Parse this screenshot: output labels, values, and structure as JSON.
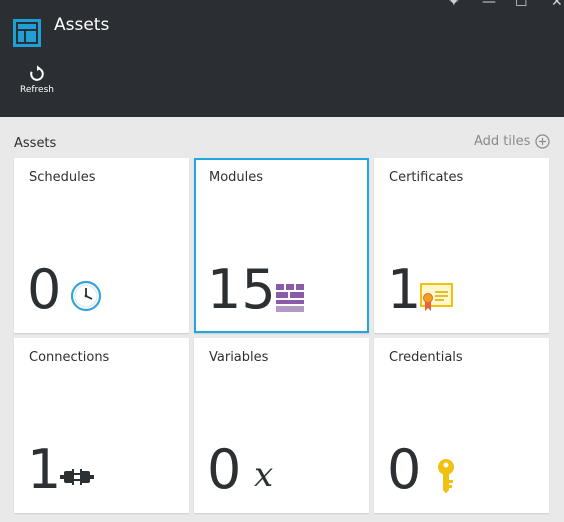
{
  "header": {
    "title": "Assets",
    "app_icon": "blade-layout-icon",
    "controls": {
      "pin": "✦",
      "minimize": "—",
      "maximize": "☐",
      "close": "✕"
    },
    "refresh": {
      "label": "Refresh",
      "icon": "refresh-icon"
    }
  },
  "section": {
    "title": "Assets",
    "add_tiles_label": "Add tiles"
  },
  "tiles": [
    {
      "title": "Schedules",
      "count": "0",
      "icon": "clock-icon",
      "selected": false
    },
    {
      "title": "Modules",
      "count": "15",
      "icon": "modules-icon",
      "selected": true
    },
    {
      "title": "Certificates",
      "count": "1",
      "icon": "certificate-icon",
      "selected": false
    },
    {
      "title": "Connections",
      "count": "1",
      "icon": "connection-plug-icon",
      "selected": false
    },
    {
      "title": "Variables",
      "count": "0",
      "icon": "variable-x-icon",
      "selected": false
    },
    {
      "title": "Credentials",
      "count": "0",
      "icon": "key-icon",
      "selected": false
    }
  ],
  "colors": {
    "header_bg": "#2b2f33",
    "accent": "#21a7de",
    "module_purple": "#8a5ba6",
    "certificate_yellow": "#f2c110",
    "key_yellow": "#f2c110",
    "page_bg": "#e9e9e9"
  }
}
